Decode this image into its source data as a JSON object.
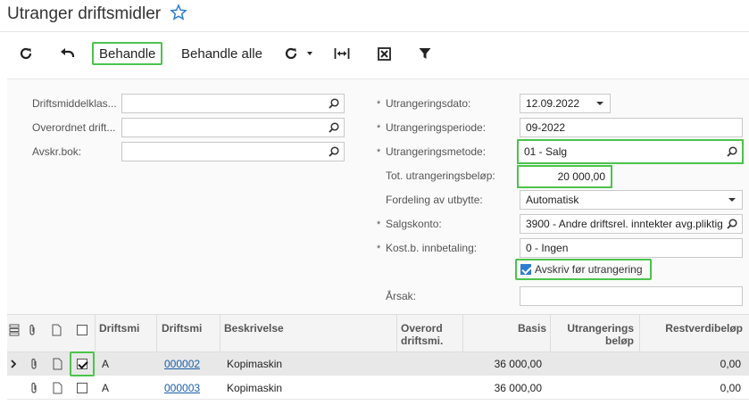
{
  "page": {
    "title": "Utranger driftsmidler"
  },
  "toolbar": {
    "refresh_icon": "refresh-icon",
    "undo_icon": "undo-icon",
    "behandle_label": "Behandle",
    "behandle_alle_label": "Behandle alle",
    "actions_icon": "actions-dropdown-icon",
    "fit_icon": "fit-width-icon",
    "export_icon": "export-excel-icon",
    "filter_icon": "filter-icon"
  },
  "form": {
    "left": [
      {
        "label": "Driftsmiddelklas...",
        "value": ""
      },
      {
        "label": "Overordnet drift...",
        "value": ""
      },
      {
        "label": "Avskr.bok:",
        "value": ""
      }
    ],
    "disposal_date": {
      "label": "Utrangeringsdato:",
      "value": "12.09.2022"
    },
    "disposal_period": {
      "label": "Utrangeringsperiode:",
      "value": "09-2022"
    },
    "disposal_method": {
      "label": "Utrangeringsmetode:",
      "value": "01 - Salg"
    },
    "disposal_amount": {
      "label": "Tot. utrangeringsbeløp:",
      "value": "20 000,00"
    },
    "proceeds_allocation": {
      "label": "Fordeling av utbytte:",
      "value": "Automatisk"
    },
    "proceeds_account": {
      "label": "Salgskonto:",
      "value": "3900 - Andre driftsrel. inntekter avg.pliktig"
    },
    "proceeds_sub": {
      "label": "Kost.b. innbetaling:",
      "value": "0 - Ingen"
    },
    "depreciate_before": {
      "label": "Avskriv før utrangering",
      "checked": true
    },
    "reason": {
      "label": "Årsak:",
      "value": ""
    }
  },
  "grid": {
    "headers": {
      "col_class": "Driftsmi",
      "col_asset": "Driftsmi",
      "col_desc": "Beskrivelse",
      "col_parent_1": "Overord",
      "col_parent_2": "driftsmi.",
      "col_basis": "Basis",
      "col_disposal_1": "Utrangerings",
      "col_disposal_2": "beløp",
      "col_residual": "Restverdibeløp"
    },
    "rows": [
      {
        "selected": true,
        "class": "A",
        "asset": "000002",
        "desc": "Kopimaskin",
        "parent": "",
        "basis": "36 000,00",
        "disposal": "",
        "residual": "0,00"
      },
      {
        "selected": false,
        "class": "A",
        "asset": "000003",
        "desc": "Kopimaskin",
        "parent": "",
        "basis": "36 000,00",
        "disposal": "",
        "residual": "0,00"
      }
    ]
  }
}
